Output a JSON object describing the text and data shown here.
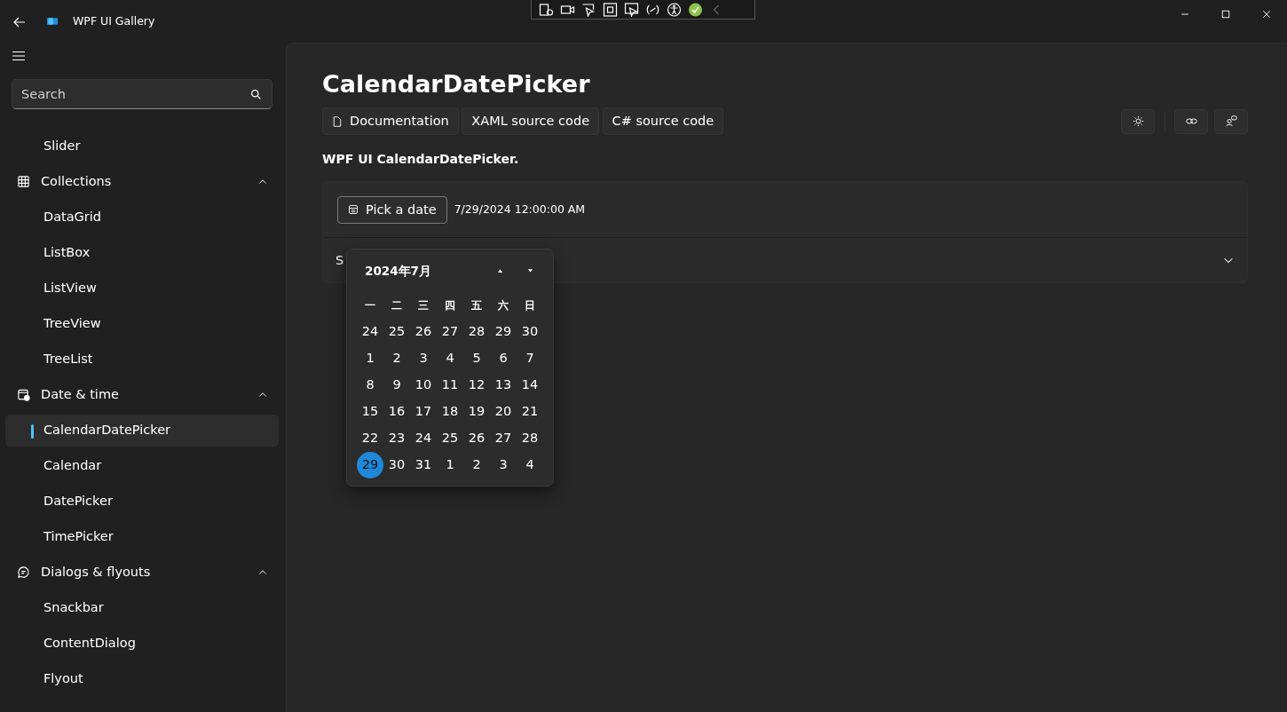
{
  "window": {
    "title": "WPF UI Gallery"
  },
  "sidebar": {
    "search": {
      "placeholder": "Search"
    },
    "items": [
      {
        "kind": "item",
        "label": "Slider",
        "selected": false
      },
      {
        "kind": "group",
        "label": "Collections",
        "expanded": true,
        "children": [
          {
            "kind": "item",
            "label": "DataGrid",
            "selected": false
          },
          {
            "kind": "item",
            "label": "ListBox",
            "selected": false
          },
          {
            "kind": "item",
            "label": "ListView",
            "selected": false
          },
          {
            "kind": "item",
            "label": "TreeView",
            "selected": false
          },
          {
            "kind": "item",
            "label": "TreeList",
            "selected": false
          }
        ]
      },
      {
        "kind": "group",
        "label": "Date & time",
        "expanded": true,
        "children": [
          {
            "kind": "item",
            "label": "CalendarDatePicker",
            "selected": true
          },
          {
            "kind": "item",
            "label": "Calendar",
            "selected": false
          },
          {
            "kind": "item",
            "label": "DatePicker",
            "selected": false
          },
          {
            "kind": "item",
            "label": "TimePicker",
            "selected": false
          }
        ]
      },
      {
        "kind": "group",
        "label": "Dialogs & flyouts",
        "expanded": true,
        "children": [
          {
            "kind": "item",
            "label": "Snackbar",
            "selected": false
          },
          {
            "kind": "item",
            "label": "ContentDialog",
            "selected": false
          },
          {
            "kind": "item",
            "label": "Flyout",
            "selected": false
          }
        ]
      }
    ]
  },
  "page": {
    "title": "CalendarDatePicker",
    "links": [
      {
        "label": "Documentation"
      },
      {
        "label": "XAML source code"
      },
      {
        "label": "C# source code"
      }
    ],
    "description": "WPF UI CalendarDatePicker.",
    "example": {
      "button": "Pick a date",
      "value": "7/29/2024 12:00:00 AM",
      "expander": {
        "label": "S",
        "expanded": false
      }
    },
    "calendar": {
      "header": "2024年7月",
      "weekdays": [
        "一",
        "二",
        "三",
        "四",
        "五",
        "六",
        "日"
      ],
      "days": [
        {
          "day": "24",
          "selected": false
        },
        {
          "day": "25",
          "selected": false
        },
        {
          "day": "26",
          "selected": false
        },
        {
          "day": "27",
          "selected": false
        },
        {
          "day": "28",
          "selected": false
        },
        {
          "day": "29",
          "selected": false
        },
        {
          "day": "30",
          "selected": false
        },
        {
          "day": "1",
          "selected": false
        },
        {
          "day": "2",
          "selected": false
        },
        {
          "day": "3",
          "selected": false
        },
        {
          "day": "4",
          "selected": false
        },
        {
          "day": "5",
          "selected": false
        },
        {
          "day": "6",
          "selected": false
        },
        {
          "day": "7",
          "selected": false
        },
        {
          "day": "8",
          "selected": false
        },
        {
          "day": "9",
          "selected": false
        },
        {
          "day": "10",
          "selected": false
        },
        {
          "day": "11",
          "selected": false
        },
        {
          "day": "12",
          "selected": false
        },
        {
          "day": "13",
          "selected": false
        },
        {
          "day": "14",
          "selected": false
        },
        {
          "day": "15",
          "selected": false
        },
        {
          "day": "16",
          "selected": false
        },
        {
          "day": "17",
          "selected": false
        },
        {
          "day": "18",
          "selected": false
        },
        {
          "day": "19",
          "selected": false
        },
        {
          "day": "20",
          "selected": false
        },
        {
          "day": "21",
          "selected": false
        },
        {
          "day": "22",
          "selected": false
        },
        {
          "day": "23",
          "selected": false
        },
        {
          "day": "24",
          "selected": false
        },
        {
          "day": "25",
          "selected": false
        },
        {
          "day": "26",
          "selected": false
        },
        {
          "day": "27",
          "selected": false
        },
        {
          "day": "28",
          "selected": false
        },
        {
          "day": "29",
          "selected": true
        },
        {
          "day": "30",
          "selected": false
        },
        {
          "day": "31",
          "selected": false
        },
        {
          "day": "1",
          "selected": false
        },
        {
          "day": "2",
          "selected": false
        },
        {
          "day": "3",
          "selected": false
        },
        {
          "day": "4",
          "selected": false
        }
      ]
    }
  }
}
